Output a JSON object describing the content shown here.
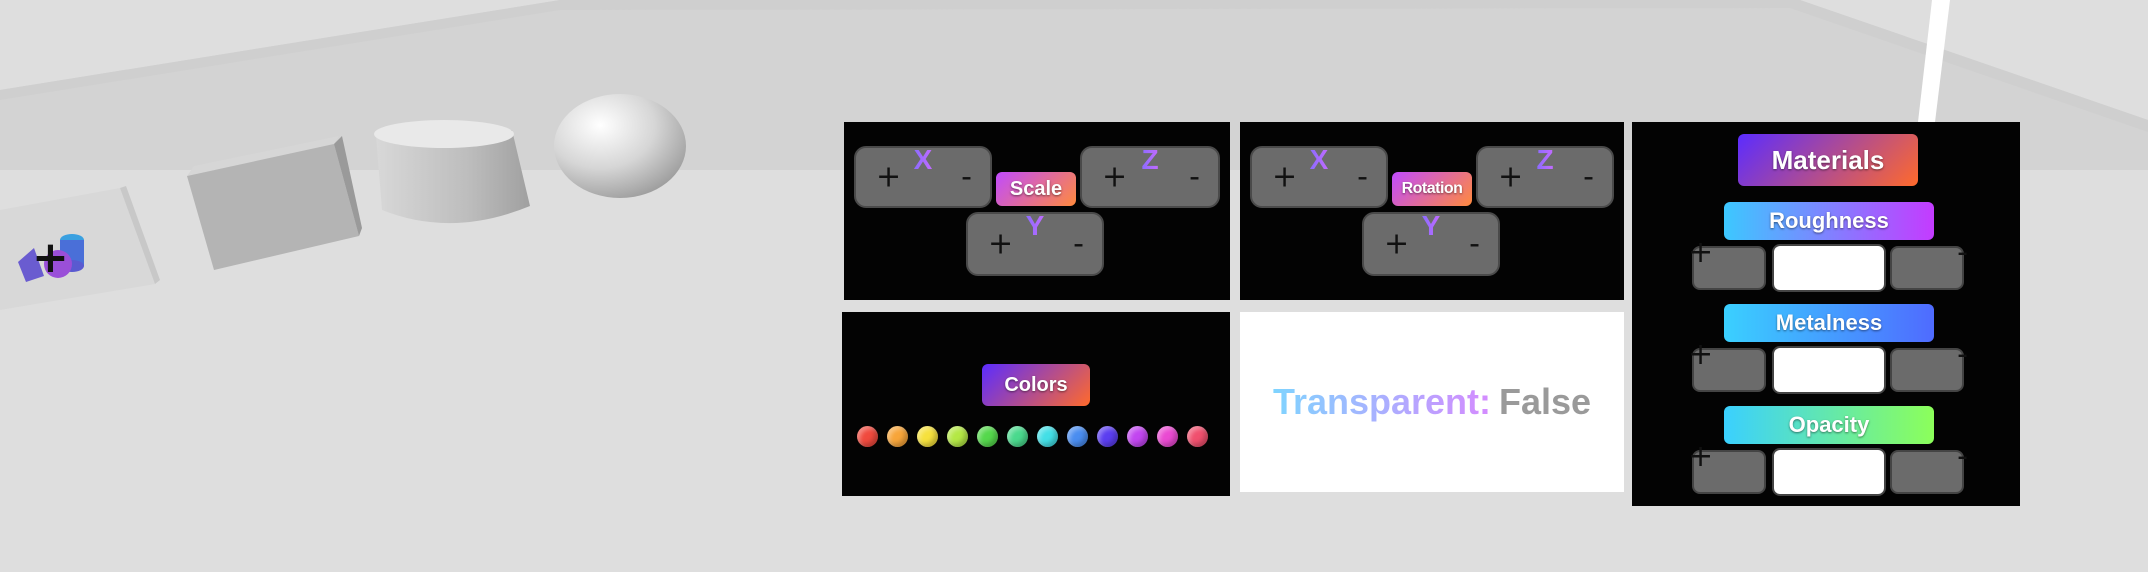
{
  "scale_panel": {
    "button_label": "Scale",
    "x": {
      "axis": "X",
      "plus": "+",
      "minus": "-"
    },
    "z": {
      "axis": "Z",
      "plus": "+",
      "minus": "-"
    },
    "y": {
      "axis": "Y",
      "plus": "+",
      "minus": "-"
    }
  },
  "rotation_panel": {
    "button_label": "Rotation",
    "x": {
      "axis": "X",
      "plus": "+",
      "minus": "-"
    },
    "z": {
      "axis": "Z",
      "plus": "+",
      "minus": "-"
    },
    "y": {
      "axis": "Y",
      "plus": "+",
      "minus": "-"
    }
  },
  "colors_panel": {
    "button_label": "Colors",
    "swatches": [
      "#f04a3e",
      "#f7a53a",
      "#f6e13d",
      "#b4e845",
      "#55d84c",
      "#4ad98d",
      "#43dfe6",
      "#4a8df0",
      "#5b3ef0",
      "#c246f0",
      "#ea4ad2",
      "#f0506e"
    ]
  },
  "transparent_panel": {
    "label": "Transparent:",
    "value": "False"
  },
  "materials_panel": {
    "title": "Materials",
    "roughness": {
      "label": "Roughness",
      "plus": "+",
      "minus": "-"
    },
    "metalness": {
      "label": "Metalness",
      "plus": "+",
      "minus": "-"
    },
    "opacity": {
      "label": "Opacity",
      "plus": "+",
      "minus": "-"
    }
  },
  "add_object_icon_name": "add-shapes-icon"
}
